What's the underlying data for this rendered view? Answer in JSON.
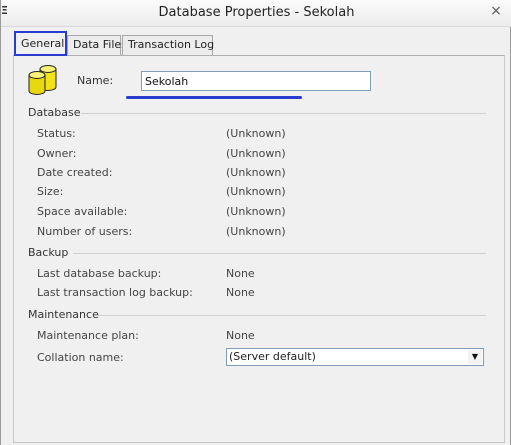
{
  "window": {
    "title": "Database Properties - Sekolah",
    "close_glyph": "×",
    "left_edge_glyph": "Ξ"
  },
  "tabs": [
    {
      "label": "General",
      "active": true
    },
    {
      "label": "Data Files",
      "active": false
    },
    {
      "label": "Transaction Log",
      "active": false
    }
  ],
  "general": {
    "name_label": "Name:",
    "name_value": "Sekolah",
    "database": {
      "title": "Database",
      "rows": [
        {
          "label": "Status:",
          "value": "(Unknown)"
        },
        {
          "label": "Owner:",
          "value": "(Unknown)"
        },
        {
          "label": "Date created:",
          "value": "(Unknown)"
        },
        {
          "label": "Size:",
          "value": "(Unknown)"
        },
        {
          "label": "Space available:",
          "value": "(Unknown)"
        },
        {
          "label": "Number of users:",
          "value": "(Unknown)"
        }
      ]
    },
    "backup": {
      "title": "Backup",
      "rows": [
        {
          "label": "Last database backup:",
          "value": "None"
        },
        {
          "label": "Last transaction log backup:",
          "value": "None"
        }
      ]
    },
    "maintenance": {
      "title": "Maintenance",
      "plan_label": "Maintenance plan:",
      "plan_value": "None",
      "collation_label": "Collation name:",
      "collation_value": "(Server default)"
    }
  },
  "icons": {
    "database": "database-cylinders-icon",
    "dropdown": "chevron-down-icon",
    "close": "close-icon"
  },
  "colors": {
    "annotation_blue": "#2a3bd0",
    "icon_yellow": "#f2e21a"
  }
}
